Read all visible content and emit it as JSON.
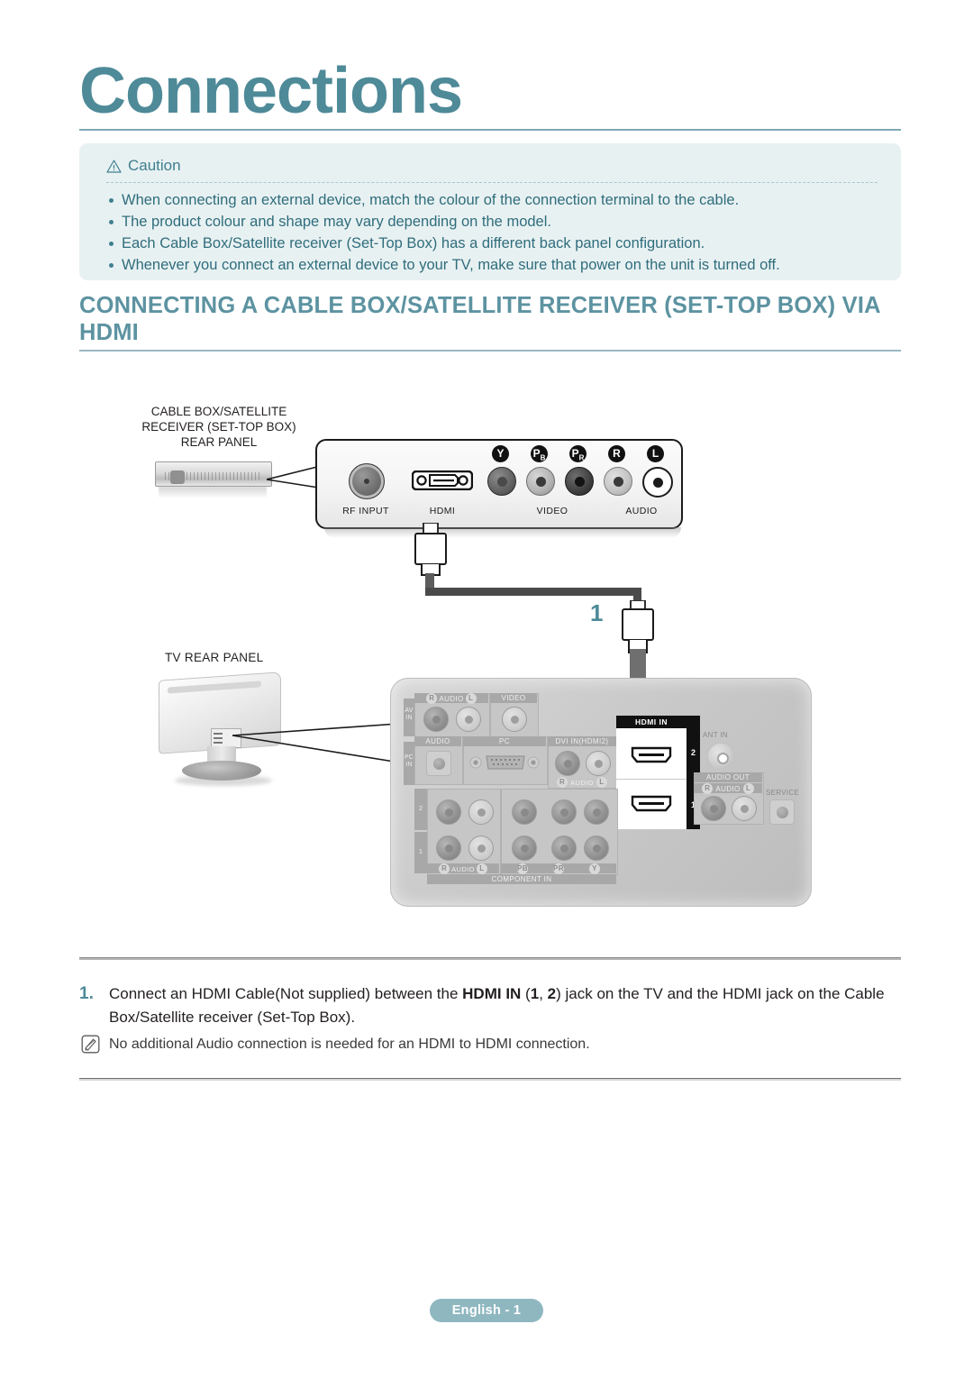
{
  "document": {
    "title": "Connections"
  },
  "caution": {
    "icon": "warning-triangle-icon",
    "heading": "Caution",
    "items": [
      "When connecting an external device, match the colour of the connection terminal to the cable.",
      "The product colour and shape may vary depending on the model.",
      "Each Cable Box/Satellite receiver (Set-Top Box) has a different back panel configuration.",
      "Whenever you connect an external device to your TV, make sure that power on the unit is turned off."
    ]
  },
  "section": {
    "heading": "CONNECTING A CABLE BOX/SATELLITE RECEIVER (SET-TOP BOX) VIA HDMI"
  },
  "diagram": {
    "stb": {
      "label_lines": [
        "CABLE BOX/SATELLITE",
        "RECEIVER (SET-TOP BOX)",
        "REAR PANEL"
      ],
      "jack_groups": [
        {
          "label": "RF INPUT"
        },
        {
          "label": "HDMI"
        },
        {
          "label": "VIDEO"
        },
        {
          "label": "AUDIO"
        }
      ],
      "connector_chips": [
        "Y",
        "PB",
        "PR",
        "R",
        "L"
      ],
      "chip_labels": [
        {
          "main": "Y",
          "sub": ""
        },
        {
          "main": "P",
          "sub": "B"
        },
        {
          "main": "P",
          "sub": "R"
        },
        {
          "main": "R",
          "sub": ""
        },
        {
          "main": "L",
          "sub": ""
        }
      ]
    },
    "cable": {
      "callout": "1"
    },
    "tv": {
      "label": "TV REAR PANEL",
      "groups": {
        "av_in_side": "AV IN",
        "av_in_audio": "AUDIO",
        "av_in_audio_r": "R",
        "av_in_audio_l": "L",
        "av_in_video": "VIDEO",
        "pc_in_side": "PC IN",
        "pc_audio": "AUDIO",
        "pc": "PC",
        "dvi_in": "DVI IN(HDMI2)",
        "dvi_audio": "AUDIO",
        "dvi_audio_r": "R",
        "dvi_audio_l": "L",
        "hdmi_in": "HDMI IN",
        "hdmi_port_2": "2",
        "hdmi_port_1": "1",
        "ant_in": "ANT IN",
        "audio_out": "AUDIO OUT",
        "audio_out_label": "AUDIO",
        "audio_out_r": "R",
        "audio_out_l": "L",
        "service": "SERVICE",
        "component_in": "COMPONENT IN",
        "component_audio": "AUDIO",
        "component_audio_r": "R",
        "component_audio_l": "L",
        "component_pb": "PB",
        "component_pr": "PR",
        "component_y": "Y",
        "component_row_2": "2",
        "component_row_1": "1"
      }
    }
  },
  "steps": [
    {
      "number": "1.",
      "text_parts": [
        {
          "t": "Connect an HDMI Cable(Not supplied) between the ",
          "bold": false
        },
        {
          "t": "HDMI IN",
          "bold": true
        },
        {
          "t": " (",
          "bold": false
        },
        {
          "t": "1",
          "bold": true
        },
        {
          "t": ", ",
          "bold": false
        },
        {
          "t": "2",
          "bold": true
        },
        {
          "t": ") jack on the TV and the HDMI jack on the Cable Box/Satellite receiver (Set-Top Box).",
          "bold": false
        }
      ]
    }
  ],
  "note": {
    "icon": "note-pencil-icon",
    "text": "No additional Audio connection is needed for an HDMI to HDMI connection."
  },
  "footer": {
    "badge": "English - 1"
  },
  "colors": {
    "accent": "#4e8a98",
    "heading": "#5d93a1",
    "caution_bg": "#e8f1f2",
    "caution_text": "#2f6d7c",
    "footer_badge": "#8fb7c0"
  }
}
